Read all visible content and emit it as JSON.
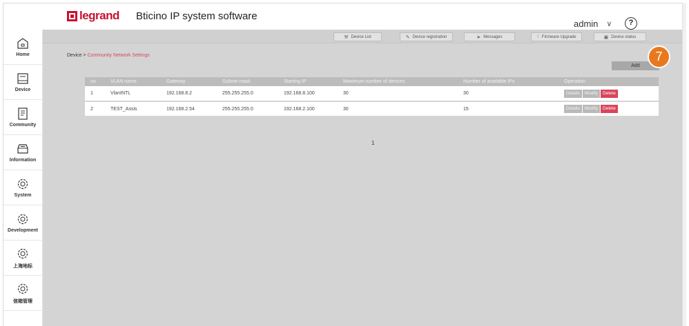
{
  "header": {
    "brand": "legrand",
    "app_title": "Bticino IP system software",
    "user": "admin",
    "help_symbol": "?",
    "brand_color": "#c8102e"
  },
  "sidebar": {
    "items": [
      {
        "label": "Home",
        "icon": "home-icon"
      },
      {
        "label": "Device",
        "icon": "device-icon"
      },
      {
        "label": "Community",
        "icon": "community-icon"
      },
      {
        "label": "Information",
        "icon": "information-icon"
      },
      {
        "label": "System",
        "icon": "gear-icon"
      },
      {
        "label": "Development",
        "icon": "gear-icon"
      },
      {
        "label": "上海地标",
        "icon": "gear-icon"
      },
      {
        "label": "信箱管理",
        "icon": "gear-icon"
      }
    ]
  },
  "toolbar": {
    "buttons": [
      {
        "label": "Device List",
        "icon": "wrench-icon"
      },
      {
        "label": "Device registration",
        "icon": "pencil-icon"
      },
      {
        "label": "Messages",
        "icon": "send-icon"
      },
      {
        "label": "Firmware Upgrade",
        "icon": "upload-icon"
      },
      {
        "label": "Device status",
        "icon": "monitor-icon"
      }
    ]
  },
  "breadcrumb": {
    "root": "Device",
    "separator": ">",
    "current": "Community Network Settings"
  },
  "add_label": "Add",
  "step_badge": "7",
  "table": {
    "columns": [
      "no",
      "VLAN name",
      "Gateway",
      "Subnet mask",
      "Starting IP",
      "Maximum number of devices",
      "Number of available IPs",
      "Operation"
    ],
    "rows": [
      {
        "no": "1",
        "vlan": "VlanINTL",
        "gateway": "192.168.8.2",
        "mask": "255.255.255.0",
        "start_ip": "192.168.8.100",
        "max_dev": "30",
        "avail": "30"
      },
      {
        "no": "2",
        "vlan": "TEST_Assis",
        "gateway": "192.168.2.54",
        "mask": "255.255.255.0",
        "start_ip": "192.168.2.100",
        "max_dev": "30",
        "avail": "15"
      }
    ],
    "actions": {
      "details": "Details",
      "modify": "Modify",
      "delete": "Delete"
    }
  },
  "pagination": {
    "current_page": "1"
  }
}
